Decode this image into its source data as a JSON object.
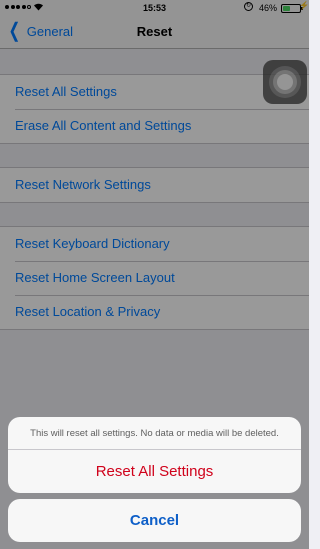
{
  "status_bar": {
    "time": "15:53",
    "battery_percent": "46%",
    "battery_level": 0.46,
    "signal_dots_filled": 4,
    "icons": [
      "signal-dots",
      "wifi-icon",
      "rotation-lock-icon",
      "battery-icon",
      "charging-bolt-icon"
    ]
  },
  "nav": {
    "back_label": "General",
    "title": "Reset"
  },
  "list": {
    "group1": [
      "Reset All Settings",
      "Erase All Content and Settings"
    ],
    "group2": [
      "Reset Network Settings"
    ],
    "group3": [
      "Reset Keyboard Dictionary",
      "Reset Home Screen Layout",
      "Reset Location & Privacy"
    ]
  },
  "action_sheet": {
    "message": "This will reset all settings. No data or media will be deleted.",
    "confirm_label": "Reset All Settings",
    "cancel_label": "Cancel"
  },
  "colors": {
    "accent": "#007aff",
    "destructive": "#d0021b",
    "background": "#efeff4"
  }
}
